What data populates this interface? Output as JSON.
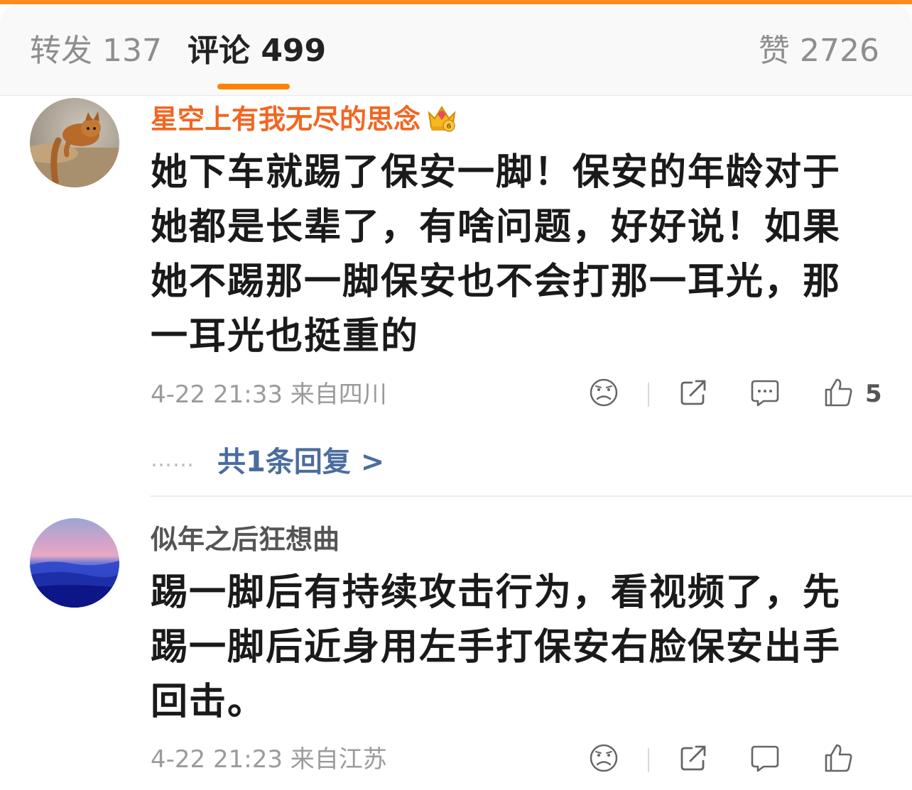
{
  "tabs": {
    "repost": "转发 137",
    "comments": "评论 499",
    "likes": "赞 2726"
  },
  "colors": {
    "accent": "#ff8200",
    "vip_name": "#f26622",
    "reply_link": "#4b6d9f"
  },
  "comments": [
    {
      "username": "星空上有我无尽的思念",
      "badge_icon": "vip-crown-icon",
      "text": "她下车就踢了保安一脚！保安的年龄对于她都是长辈了，有啥问题，好好说！如果她不踢那一脚保安也不会打那一耳光，那一耳光也挺重的",
      "meta": "4-22 21:33 来自四川",
      "like_count": "5",
      "replies_dots": "……",
      "replies_link": "共1条回复 >"
    },
    {
      "username": "似年之后狂想曲",
      "text": "踢一脚后有持续攻击行为，看视频了，先踢一脚后近身用左手打保安右脸保安出手回击。",
      "meta": "4-22 21:23 来自江苏"
    }
  ],
  "action_icons": [
    "dislike-face-icon",
    "share-icon",
    "comment-icon",
    "thumbs-up-icon"
  ]
}
